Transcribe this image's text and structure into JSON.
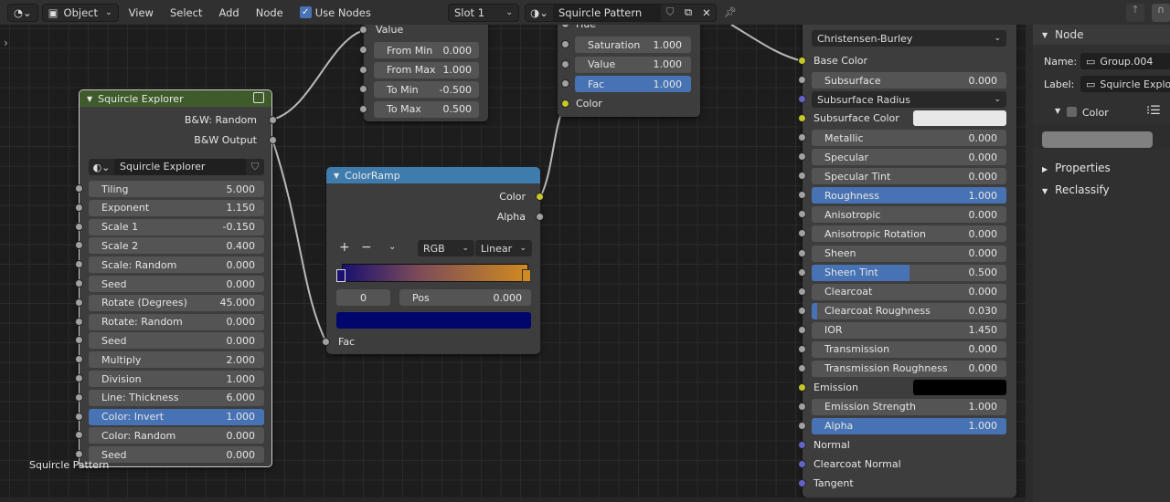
{
  "header": {
    "editor_icon": "node-editor-icon",
    "mode_icon": "object-mode-icon",
    "mode": "Object",
    "menus": [
      "View",
      "Select",
      "Add",
      "Node"
    ],
    "use_nodes_label": "Use Nodes",
    "use_nodes_checked": true,
    "slot": "Slot 1",
    "material_icon": "material-sphere-icon",
    "material": "Squircle Pattern"
  },
  "frame_label": "Squircle Pattern",
  "squircle": {
    "title": "Squircle Explorer",
    "header_color": "#3f5b2c",
    "outputs": [
      "B&W: Random",
      "B&W Output"
    ],
    "datablock": "Squircle Explorer",
    "inputs": [
      {
        "label": "Tiling",
        "value": "5.000",
        "fill": 0
      },
      {
        "label": "Exponent",
        "value": "1.150",
        "fill": 0
      },
      {
        "label": "Scale 1",
        "value": "-0.150",
        "fill": 0
      },
      {
        "label": "Scale 2",
        "value": "0.400",
        "fill": 0
      },
      {
        "label": "Scale: Random",
        "value": "0.000",
        "fill": 0
      },
      {
        "label": "Seed",
        "value": "0.000",
        "fill": 0
      },
      {
        "label": "Rotate (Degrees)",
        "value": "45.000",
        "fill": 0
      },
      {
        "label": "Rotate: Random",
        "value": "0.000",
        "fill": 0
      },
      {
        "label": "Seed",
        "value": "0.000",
        "fill": 0
      },
      {
        "label": "Multiply",
        "value": "2.000",
        "fill": 0
      },
      {
        "label": "Division",
        "value": "1.000",
        "fill": 0
      },
      {
        "label": "Line: Thickness",
        "value": "6.000",
        "fill": 0
      },
      {
        "label": "Color: Invert",
        "value": "1.000",
        "fill": 1
      },
      {
        "label": "Color: Random",
        "value": "0.000",
        "fill": 0
      },
      {
        "label": "Seed",
        "value": "0.000",
        "fill": 0
      }
    ]
  },
  "maprange": {
    "socket": "Value",
    "inputs": [
      {
        "label": "From Min",
        "value": "0.000"
      },
      {
        "label": "From Max",
        "value": "1.000"
      },
      {
        "label": "To Min",
        "value": "-0.500"
      },
      {
        "label": "To Max",
        "value": "0.500"
      }
    ]
  },
  "huesat": {
    "hue": "Hue",
    "inputs": [
      {
        "label": "Saturation",
        "value": "1.000",
        "fill": 0
      },
      {
        "label": "Value",
        "value": "1.000",
        "fill": 0
      },
      {
        "label": "Fac",
        "value": "1.000",
        "fill": 1
      }
    ],
    "output": "Color"
  },
  "colorramp": {
    "title": "ColorRamp",
    "header_color": "#3f7cae",
    "outputs": [
      "Color",
      "Alpha"
    ],
    "color_mode": "RGB",
    "interpolation": "Linear",
    "stop_index": "0",
    "pos_label": "Pos",
    "pos_value": "0.000",
    "stop_colors": [
      "#1a1070",
      "#d08a20"
    ],
    "active_color": "#00066b",
    "input": "Fac"
  },
  "principled": {
    "subsurface_method": "Christensen-Burley",
    "rows": [
      {
        "label": "Base Color",
        "type": "label",
        "socket": "yellow"
      },
      {
        "label": "Subsurface",
        "value": "0.000",
        "type": "field",
        "socket": "gray",
        "fill": 0
      },
      {
        "label": "Subsurface Radius",
        "type": "dropdown",
        "socket": "purple"
      },
      {
        "label": "Subsurface Color",
        "type": "color",
        "socket": "yellow",
        "color": "#e8e8e8"
      },
      {
        "label": "Metallic",
        "value": "0.000",
        "type": "field",
        "socket": "gray",
        "fill": 0
      },
      {
        "label": "Specular",
        "value": "0.000",
        "type": "field",
        "socket": "gray",
        "fill": 0
      },
      {
        "label": "Specular Tint",
        "value": "0.000",
        "type": "field",
        "socket": "gray",
        "fill": 0
      },
      {
        "label": "Roughness",
        "value": "1.000",
        "type": "field",
        "socket": "gray",
        "fill": 1
      },
      {
        "label": "Anisotropic",
        "value": "0.000",
        "type": "field",
        "socket": "gray",
        "fill": 0
      },
      {
        "label": "Anisotropic Rotation",
        "value": "0.000",
        "type": "field",
        "socket": "gray",
        "fill": 0
      },
      {
        "label": "Sheen",
        "value": "0.000",
        "type": "field",
        "socket": "gray",
        "fill": 0
      },
      {
        "label": "Sheen Tint",
        "value": "0.500",
        "type": "field",
        "socket": "gray",
        "fill": 0.5
      },
      {
        "label": "Clearcoat",
        "value": "0.000",
        "type": "field",
        "socket": "gray",
        "fill": 0
      },
      {
        "label": "Clearcoat Roughness",
        "value": "0.030",
        "type": "field",
        "socket": "gray",
        "fill": 0.03
      },
      {
        "label": "IOR",
        "value": "1.450",
        "type": "field",
        "socket": "gray",
        "fill": 0
      },
      {
        "label": "Transmission",
        "value": "0.000",
        "type": "field",
        "socket": "gray",
        "fill": 0
      },
      {
        "label": "Transmission Roughness",
        "value": "0.000",
        "type": "field",
        "socket": "gray",
        "fill": 0
      },
      {
        "label": "Emission",
        "type": "color",
        "socket": "yellow",
        "color": "#000000"
      },
      {
        "label": "Emission Strength",
        "value": "1.000",
        "type": "field",
        "socket": "gray",
        "fill": 0
      },
      {
        "label": "Alpha",
        "value": "1.000",
        "type": "field",
        "socket": "gray",
        "fill": 1
      },
      {
        "label": "Normal",
        "type": "label",
        "socket": "purple"
      },
      {
        "label": "Clearcoat Normal",
        "type": "label",
        "socket": "purple"
      },
      {
        "label": "Tangent",
        "type": "label",
        "socket": "purple"
      }
    ]
  },
  "sidebar": {
    "node_section": "Node",
    "name_label": "Name:",
    "name_value": "Group.004",
    "label_label": "Label:",
    "label_value": "Squircle Explor.",
    "color_label": "Color",
    "properties": "Properties",
    "reclassify": "Reclassify"
  },
  "socket_colors": {
    "gray": "#a1a1a1",
    "yellow": "#c7c729",
    "purple": "#6363c7"
  },
  "accent": "#4772b3"
}
